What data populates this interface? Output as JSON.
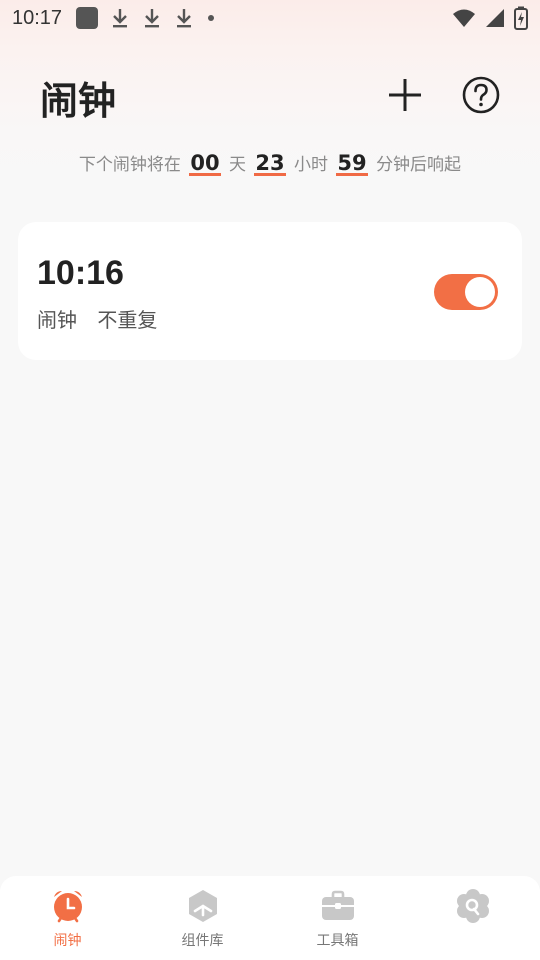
{
  "status_bar": {
    "time": "10:17"
  },
  "header": {
    "title": "闹钟"
  },
  "countdown": {
    "prefix": "下个闹钟将在",
    "days": "00",
    "days_unit": "天",
    "hours": "23",
    "hours_unit": "小时",
    "minutes": "59",
    "minutes_suffix": "分钟后响起"
  },
  "alarms": [
    {
      "time": "10:16",
      "label": "闹钟",
      "repeat": "不重复",
      "enabled": true
    }
  ],
  "bottom_nav": {
    "items": [
      {
        "label": "闹钟",
        "icon": "alarm-clock-icon",
        "active": true
      },
      {
        "label": "组件库",
        "icon": "widget-cube-icon",
        "active": false
      },
      {
        "label": "工具箱",
        "icon": "toolbox-icon",
        "active": false
      },
      {
        "label": "",
        "icon": "settings-flower-icon",
        "active": false
      }
    ]
  },
  "colors": {
    "accent": "#f26f45",
    "inactive_icon": "#c8c8c8"
  }
}
